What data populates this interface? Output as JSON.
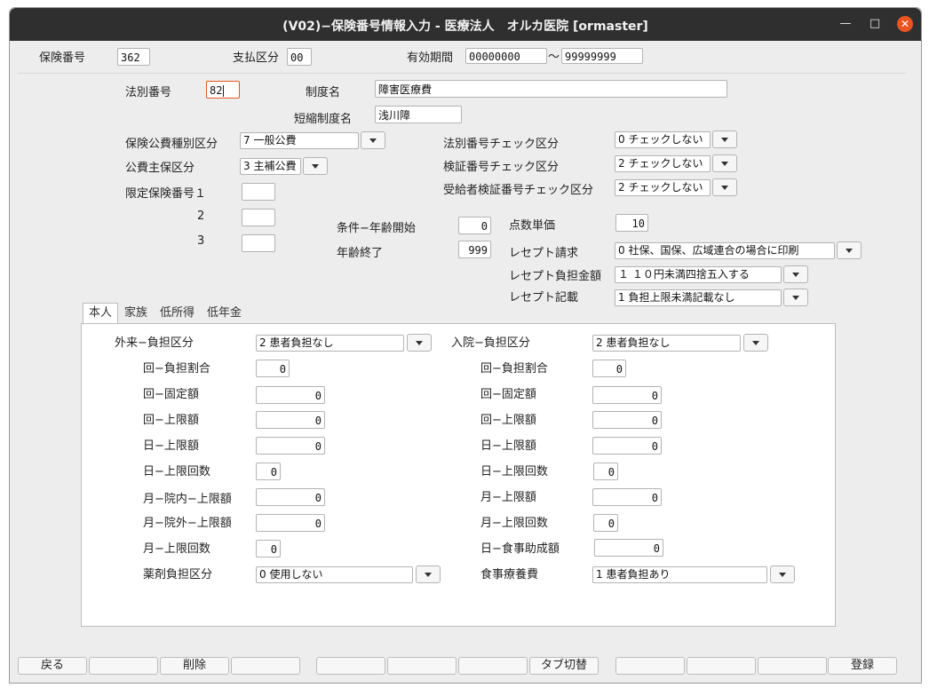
{
  "window": {
    "title": "(V02)−保険番号情報入力 - 医療法人　オルカ医院  [ormaster]"
  },
  "header": {
    "hokenno_label": "保険番号",
    "hokenno_value": "362",
    "shiharai_label": "支払区分",
    "shiharai_value": "00",
    "yuko_label": "有効期間",
    "yuko_start": "00000000",
    "yuko_sep": "〜",
    "yuko_end": "99999999"
  },
  "main": {
    "houbetsu_label": "法別番号",
    "houbetsu_value": "82",
    "seido_label": "制度名",
    "seido_value": "障害医療費",
    "tanshuku_label": "短縮制度名",
    "tanshuku_value": "浅川障",
    "kohi_shubetsu_label": "保険公費種別区分",
    "kohi_shubetsu_value": "7 一般公費",
    "kohi_shuho_label": "公費主保区分",
    "kohi_shuho_value": "3 主補公費",
    "gentei_label": "限定保険番号１",
    "gentei_2_label": "2",
    "gentei_3_label": "3",
    "houbetsu_check_label": "法別番号チェック区分",
    "houbetsu_check_value": "0 チェックしない",
    "kensho_check_label": "検証番号チェック区分",
    "kensho_check_value": "2 チェックしない",
    "jukyusha_check_label": "受給者検証番号チェック区分",
    "jukyusha_check_value": "2 チェックしない",
    "joken_label": "条件−年齢開始",
    "joken_value": "0",
    "nenrei_label": "年齢終了",
    "nenrei_value": "999",
    "tensu_label": "点数単価",
    "tensu_value": "10",
    "receipt_seikyu_label": "レセプト請求",
    "receipt_seikyu_value": "0 社保、国保、広域連合の場合に印刷",
    "receipt_futan_label": "レセプト負担金額",
    "receipt_futan_value": "１ １０円未満四捨五入する",
    "receipt_kisai_label": "レセプト記載",
    "receipt_kisai_value": "1 負担上限未満記載なし"
  },
  "tabs": [
    "本人",
    "家族",
    "低所得",
    "低年金"
  ],
  "gairai": {
    "kubun_label": "外来−負担区分",
    "kubun_value": "2 患者負担なし",
    "rows": [
      {
        "label": "回−負担割合",
        "value": "0"
      },
      {
        "label": "回−固定額",
        "value": "0"
      },
      {
        "label": "回−上限額",
        "value": "0"
      },
      {
        "label": "日−上限額",
        "value": "0"
      },
      {
        "label": "日−上限回数",
        "value": "0"
      },
      {
        "label": "月−院内−上限額",
        "value": "0"
      },
      {
        "label": "月−院外−上限額",
        "value": "0"
      },
      {
        "label": "月−上限回数",
        "value": "0"
      }
    ],
    "yakuzai_label": "薬剤負担区分",
    "yakuzai_value": "0 使用しない"
  },
  "nyuin": {
    "kubun_label": "入院−負担区分",
    "kubun_value": "2 患者負担なし",
    "rows": [
      {
        "label": "回−負担割合",
        "value": "0"
      },
      {
        "label": "回−固定額",
        "value": "0"
      },
      {
        "label": "回−上限額",
        "value": "0"
      },
      {
        "label": "日−上限額",
        "value": "0"
      },
      {
        "label": "日−上限回数",
        "value": "0"
      },
      {
        "label": "月−上限額",
        "value": "0"
      },
      {
        "label": "月−上限回数",
        "value": "0"
      },
      {
        "label": "日−食事助成額",
        "value": "0"
      }
    ],
    "shokuji_label": "食事療養費",
    "shokuji_value": "1 患者負担あり"
  },
  "footer": [
    "戻る",
    "",
    "削除",
    "",
    "",
    "",
    "",
    "タブ切替",
    "",
    "",
    "",
    "登録"
  ]
}
